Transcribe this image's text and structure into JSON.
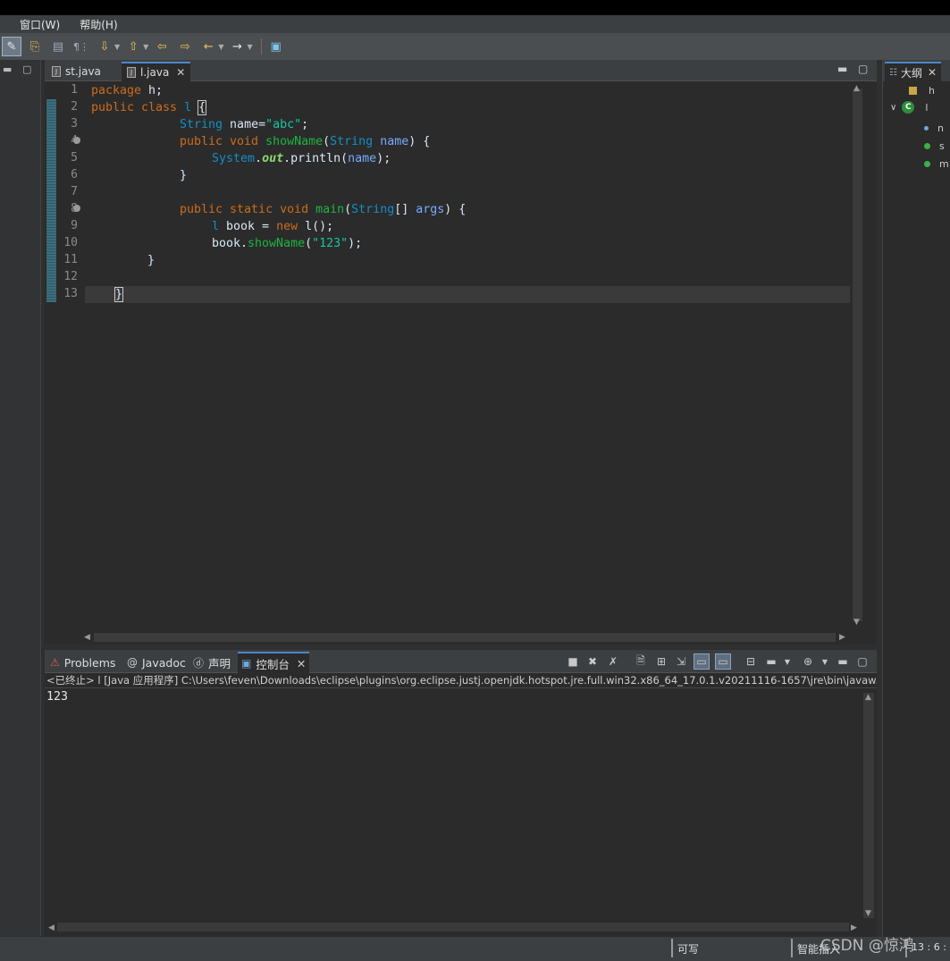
{
  "menubar": {
    "items": [
      "窗口(W)",
      "帮助(H)"
    ]
  },
  "toolbar": {
    "buttons": [
      "toggle-mark-occurrences",
      "toggle-breadcrumb",
      "toggle-block-selection",
      "show-whitespace",
      "next-annotation",
      "previous-annotation",
      "last-edit-location",
      "back",
      "forward",
      "open-task"
    ]
  },
  "editor": {
    "tabs": [
      {
        "label": "st.java",
        "selected": false
      },
      {
        "label": "l.java",
        "selected": true
      }
    ],
    "line_numbers": [
      "1",
      "2",
      "3",
      "4",
      "5",
      "6",
      "7",
      "8",
      "9",
      "10",
      "11",
      "12",
      "13"
    ],
    "code": [
      [
        "package",
        " h;"
      ],
      [
        "public class",
        " ",
        "l",
        " ",
        "{"
      ],
      [
        "String",
        " name=",
        "\"abc\"",
        ";"
      ],
      [
        "public void",
        " ",
        "showName",
        "(",
        "String",
        " ",
        "name",
        ") {"
      ],
      [
        "System",
        ".",
        "out",
        ".println(",
        "name",
        ");"
      ],
      [
        "}"
      ],
      [
        ""
      ],
      [
        "public static void",
        " ",
        "main",
        "(",
        "String",
        "[] ",
        "args",
        ") {"
      ],
      [
        "l",
        " book = ",
        "new",
        " l();"
      ],
      [
        "book.",
        "showName",
        "(",
        "\"123\"",
        ");"
      ],
      [
        "}"
      ],
      [
        ""
      ],
      [
        "}"
      ]
    ]
  },
  "console": {
    "tabs": [
      {
        "label": "Problems",
        "icon": "problems-icon"
      },
      {
        "label": "Javadoc",
        "icon": "javadoc-icon"
      },
      {
        "label": "声明",
        "icon": "declaration-icon"
      },
      {
        "label": "控制台",
        "icon": "console-icon",
        "selected": true
      }
    ],
    "status": "<已终止> l [Java 应用程序] C:\\Users\\feven\\Downloads\\eclipse\\plugins\\org.eclipse.justj.openjdk.hotspot.jre.full.win32.x86_64_17.0.1.v20211116-1657\\jre\\bin\\javaw.",
    "output": "123"
  },
  "outline": {
    "tab_label": "大纲",
    "nodes": [
      {
        "label": "h",
        "kind": "package"
      },
      {
        "label": "l",
        "kind": "class"
      },
      {
        "label": "n",
        "kind": "field"
      },
      {
        "label": "s",
        "kind": "method"
      },
      {
        "label": "m",
        "kind": "method"
      }
    ]
  },
  "statusbar": {
    "writable": "可写",
    "insert_mode": "智能插入",
    "position": "13 : 6 :"
  },
  "watermark": "CSDN @惊鸿",
  "colors": {
    "keyword": "#cc6c1d",
    "type": "#1290c3",
    "string": "#17c6a3",
    "method": "#1eb540",
    "parameter": "#79abff",
    "background": "#2b2b2b"
  }
}
